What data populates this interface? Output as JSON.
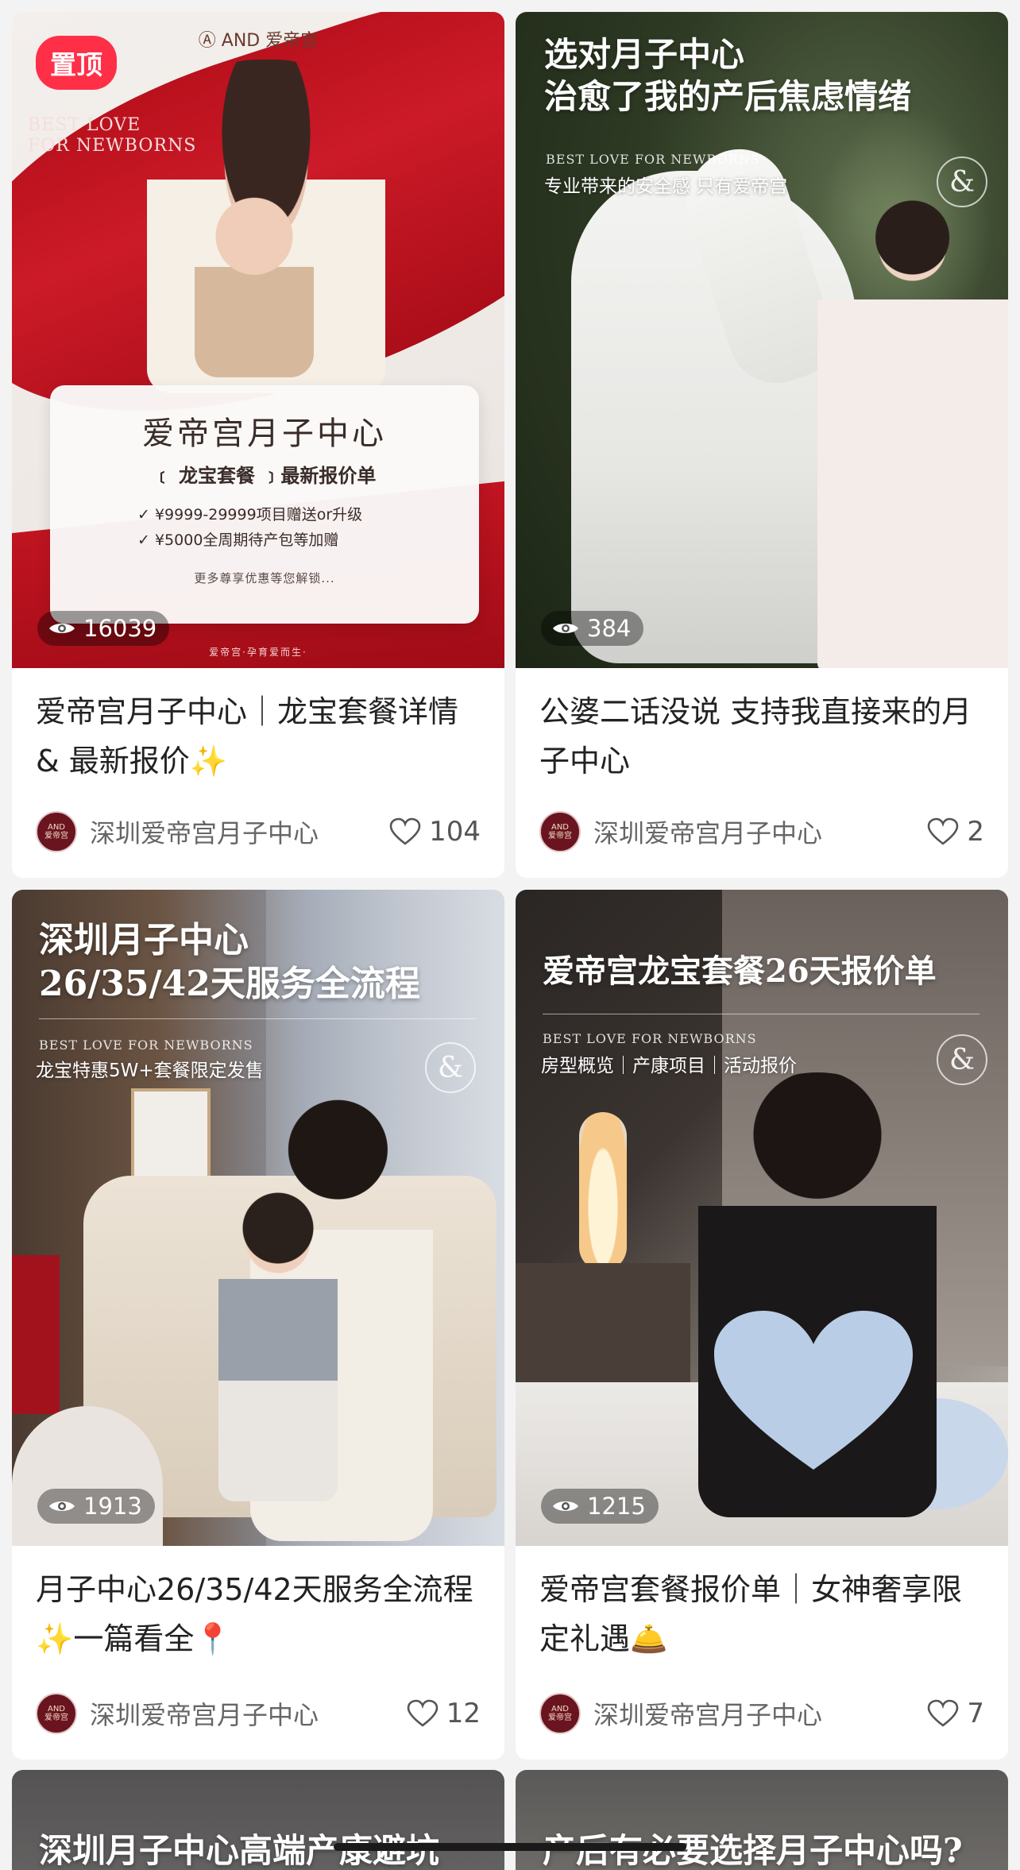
{
  "posts": [
    {
      "pinned_label": "置顶",
      "views": "16039",
      "title": "爱帝宫月子中心｜龙宝套餐详情 & 最新报价✨",
      "author": "深圳爱帝宫月子中心",
      "likes": "104",
      "cover": {
        "brand": "Ⓐ AND 爱帝宫",
        "best_love": "BEST LOVE\nFOR NEWBORNS",
        "poster_title": "爱帝宫月子中心",
        "poster_subtitle": "﹝ 龙宝套餐 ﹞最新报价单",
        "line1": "✓ ¥9999-29999项目赠送or升级",
        "line2": "✓ ¥5000全周期待产包等加赠",
        "more": "更多尊享优惠等您解锁...",
        "footer": "爱帝宫·孕育爱而生·"
      }
    },
    {
      "views": "384",
      "title": "公婆二话没说 支持我直接来的月子中心",
      "author": "深圳爱帝宫月子中心",
      "likes": "2",
      "cover": {
        "headline": "选对月子中心\n治愈了我的产后焦虑情绪",
        "en": "BEST LOVE FOR NEWBORNS",
        "sub": "专业带来的安全感 只有爱帝宫",
        "amp": "&"
      }
    },
    {
      "views": "1913",
      "title": "月子中心26/35/42天服务全流程✨一篇看全📍",
      "author": "深圳爱帝宫月子中心",
      "likes": "12",
      "cover": {
        "headline": "深圳月子中心\n26/35/42天服务全流程",
        "en": "BEST LOVE FOR NEWBORNS",
        "sub": "龙宝特惠5W+套餐限定发售",
        "amp": "&"
      }
    },
    {
      "views": "1215",
      "title": "爱帝宫套餐报价单｜女神奢享限定礼遇🛎️",
      "author": "深圳爱帝宫月子中心",
      "likes": "7",
      "cover": {
        "headline": "爱帝宫龙宝套餐26天报价单",
        "en": "BEST LOVE FOR NEWBORNS",
        "sub": "房型概览｜产康项目｜活动报价",
        "amp": "&"
      }
    },
    {
      "cover": {
        "headline": "深圳月子中心高端产康避坑"
      }
    },
    {
      "cover": {
        "headline": "产后有必要选择月子中心吗?"
      }
    }
  ],
  "avatar_text": "AND\n爱帝宫"
}
